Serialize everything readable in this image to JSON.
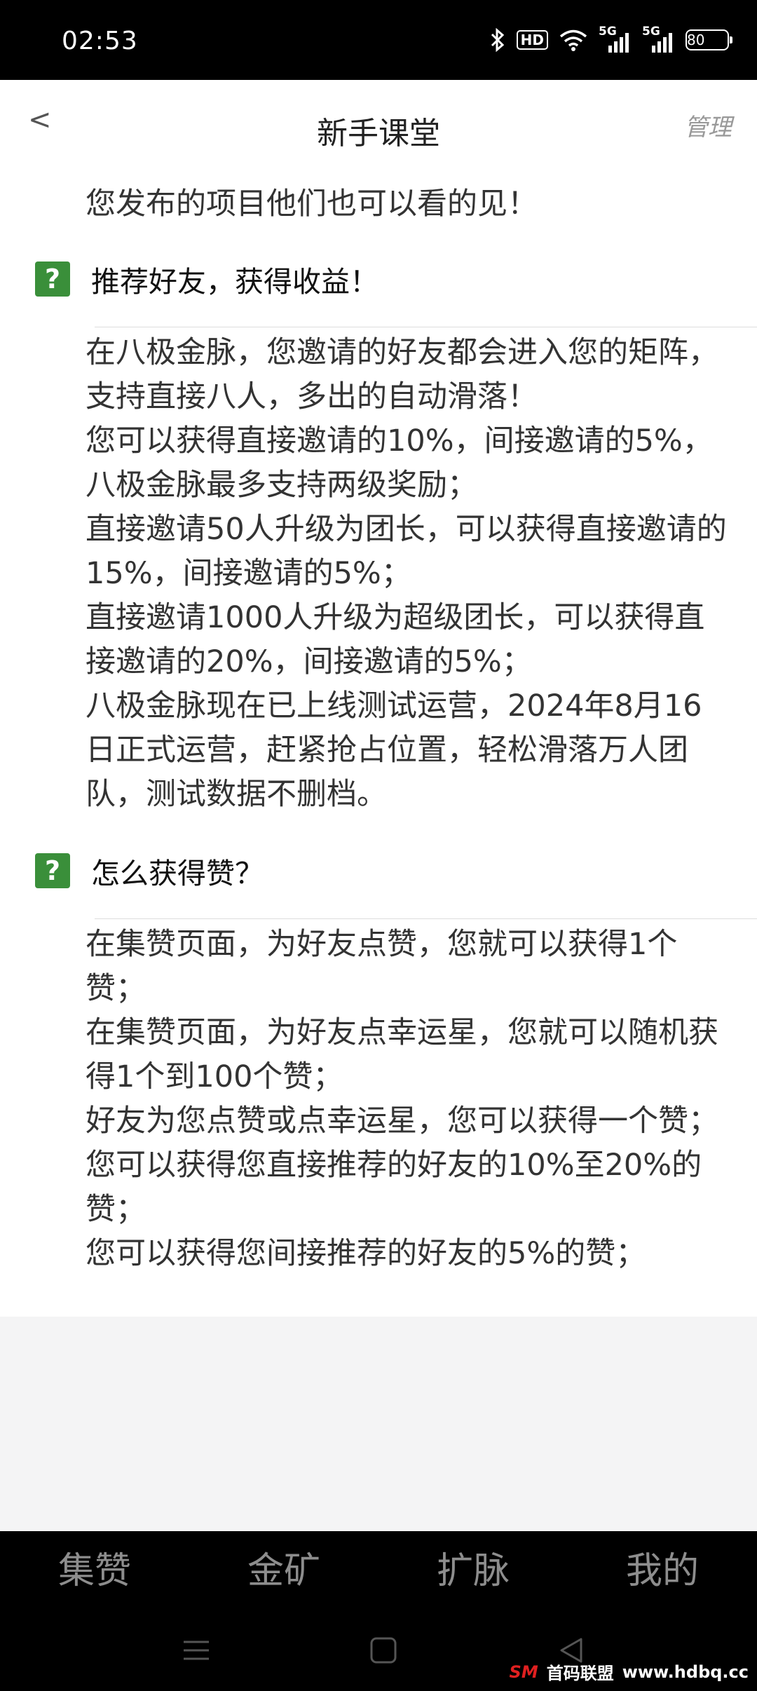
{
  "status_bar": {
    "time": "02:53",
    "hd_label": "HD",
    "sim1_label": "5G",
    "sim2_label": "5G",
    "battery": "80",
    "icons": [
      "bluetooth-icon",
      "hd-icon",
      "wifi-icon",
      "signal-icon",
      "signal-icon",
      "battery-icon"
    ]
  },
  "header": {
    "back_icon": "<",
    "title": "新手课堂",
    "manage": "管理"
  },
  "content": {
    "partial_top": "您发布的项目他们也可以看的见！",
    "sections": [
      {
        "icon": "?",
        "title": "推荐好友，获得收益！",
        "body": [
          "在八极金脉，您邀请的好友都会进入您的矩阵，支持直接八人，多出的自动滑落！",
          "您可以获得直接邀请的10%，间接邀请的5%，八极金脉最多支持两级奖励；",
          "直接邀请50人升级为团长，可以获得直接邀请的15%，间接邀请的5%；",
          "直接邀请1000人升级为超级团长，可以获得直接邀请的20%，间接邀请的5%；",
          "八极金脉现在已上线测试运营，2024年8月16日正式运营，赶紧抢占位置，轻松滑落万人团队，测试数据不删档。"
        ]
      },
      {
        "icon": "?",
        "title": "怎么获得赞？",
        "body": [
          "在集赞页面，为好友点赞，您就可以获得1个赞；",
          "在集赞页面，为好友点幸运星，您就可以随机获得1个到100个赞；",
          "好友为您点赞或点幸运星，您可以获得一个赞；",
          "您可以获得您直接推荐的好友的10%至20%的赞；",
          "您可以获得您间接推荐的好友的5%的赞；"
        ]
      }
    ]
  },
  "bottom_nav": [
    "集赞",
    "金矿",
    "扩脉",
    "我的"
  ],
  "system_nav": [
    "menu-icon",
    "home-square-icon",
    "back-triangle-icon"
  ],
  "watermark": {
    "logo": "SM",
    "name": "首码联盟",
    "url": "www.hdbq.cc"
  }
}
